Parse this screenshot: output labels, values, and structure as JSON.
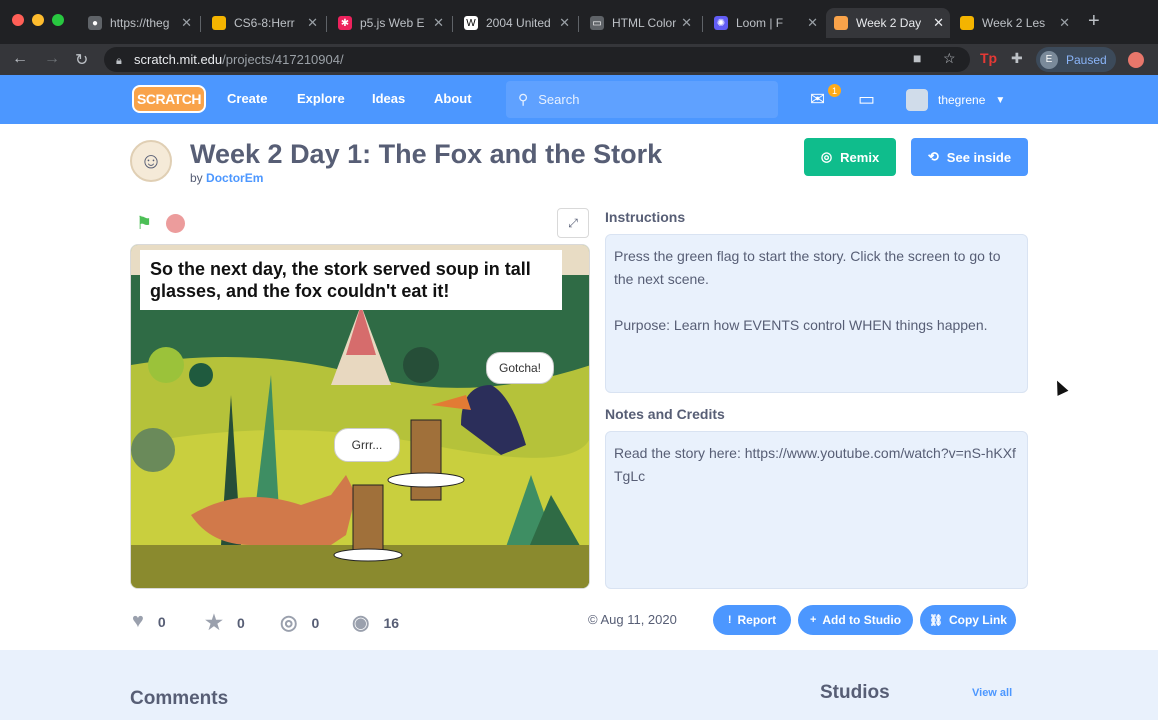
{
  "browser": {
    "tabs": [
      {
        "label": "https://theg"
      },
      {
        "label": "CS6-8:Herr"
      },
      {
        "label": "p5.js Web E"
      },
      {
        "label": "2004 United"
      },
      {
        "label": "HTML Color"
      },
      {
        "label": "Loom | F"
      },
      {
        "label": "Week 2 Day"
      },
      {
        "label": "Week 2 Les"
      }
    ],
    "url_host": "scratch.mit.edu",
    "url_path": "/projects/417210904/",
    "profile_initial": "E",
    "profile_status": "Paused"
  },
  "site_nav": {
    "logo": "SCRATCH",
    "links": [
      "Create",
      "Explore",
      "Ideas",
      "About"
    ],
    "search_placeholder": "Search",
    "messages_count": "1",
    "username": "thegrene"
  },
  "project": {
    "title": "Week 2 Day 1: The Fox and the Stork",
    "by_prefix": "by",
    "author": "DoctorEm",
    "remix_label": "Remix",
    "see_inside_label": "See inside"
  },
  "stage": {
    "caption": "So the next day, the stork served soup in tall glasses, and the fox couldn't eat it!",
    "bubble_fox": "Grrr...",
    "bubble_stork": "Gotcha!"
  },
  "instructions": {
    "label": "Instructions",
    "line1": "Press the green flag to start the story. Click the screen to go to the next scene.",
    "line2": "Purpose: Learn how EVENTS control WHEN things happen."
  },
  "notes": {
    "label": "Notes and Credits",
    "text": "Read the story here: https://www.youtube.com/watch?v=nS-hKXfTgLc"
  },
  "stats": {
    "loves": "0",
    "favorites": "0",
    "remixes": "0",
    "views": "16"
  },
  "footer": {
    "date": "© Aug 11, 2020",
    "report": "Report",
    "add_to_studio": "Add to Studio",
    "copy_link": "Copy Link"
  },
  "lower": {
    "comments": "Comments",
    "studios": "Studios",
    "view_all": "View all"
  }
}
